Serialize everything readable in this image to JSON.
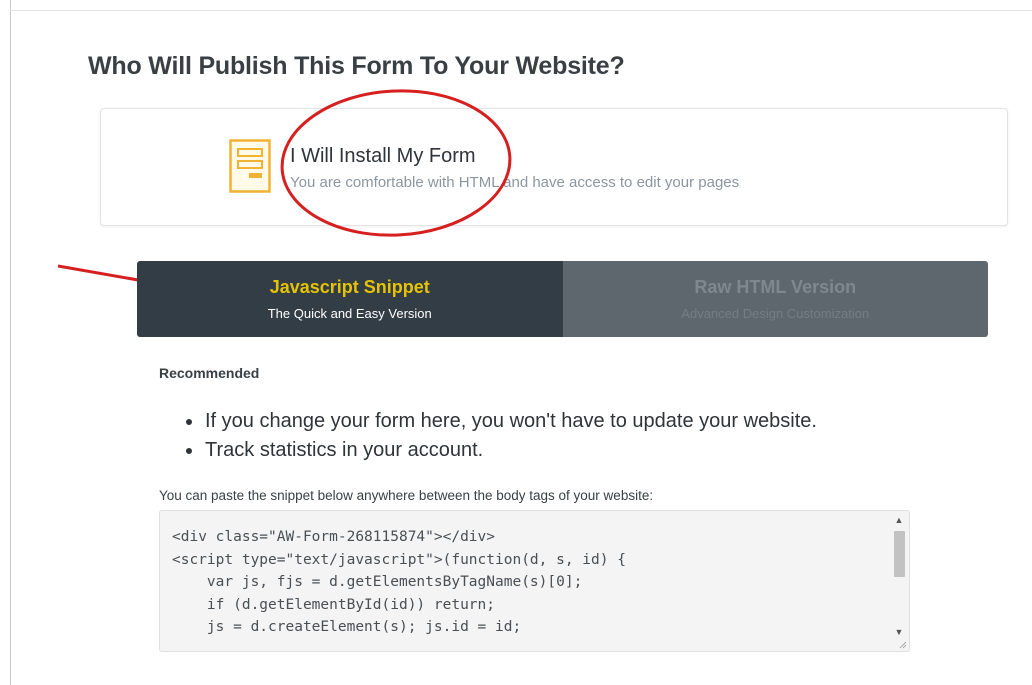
{
  "heading": "Who Will Publish This Form To Your Website?",
  "option": {
    "title": "I Will Install My Form",
    "description": "You are comfortable with HTML and have access to edit your pages",
    "icon": "form-document-icon"
  },
  "tabs": [
    {
      "title": "Javascript Snippet",
      "subtitle": "The Quick and Easy Version",
      "active": true
    },
    {
      "title": "Raw HTML Version",
      "subtitle": "Advanced Design Customization",
      "active": false
    }
  ],
  "recommended_label": "Recommended",
  "benefits": [
    "If you change your form here, you won't have to update your website.",
    "Track statistics in your account."
  ],
  "paste_instructions": "You can paste the snippet below anywhere between the body tags of your website:",
  "code_snippet": "<div class=\"AW-Form-268115874\"></div>\n<script type=\"text/javascript\">(function(d, s, id) {\n    var js, fjs = d.getElementsByTagName(s)[0];\n    if (d.getElementById(id)) return;\n    js = d.createElement(s); js.id = id;",
  "colors": {
    "accent_yellow": "#e6c300",
    "tab_active_bg": "#333d45",
    "tab_inactive_bg": "#5e676d",
    "annotation_red": "#d62020"
  }
}
